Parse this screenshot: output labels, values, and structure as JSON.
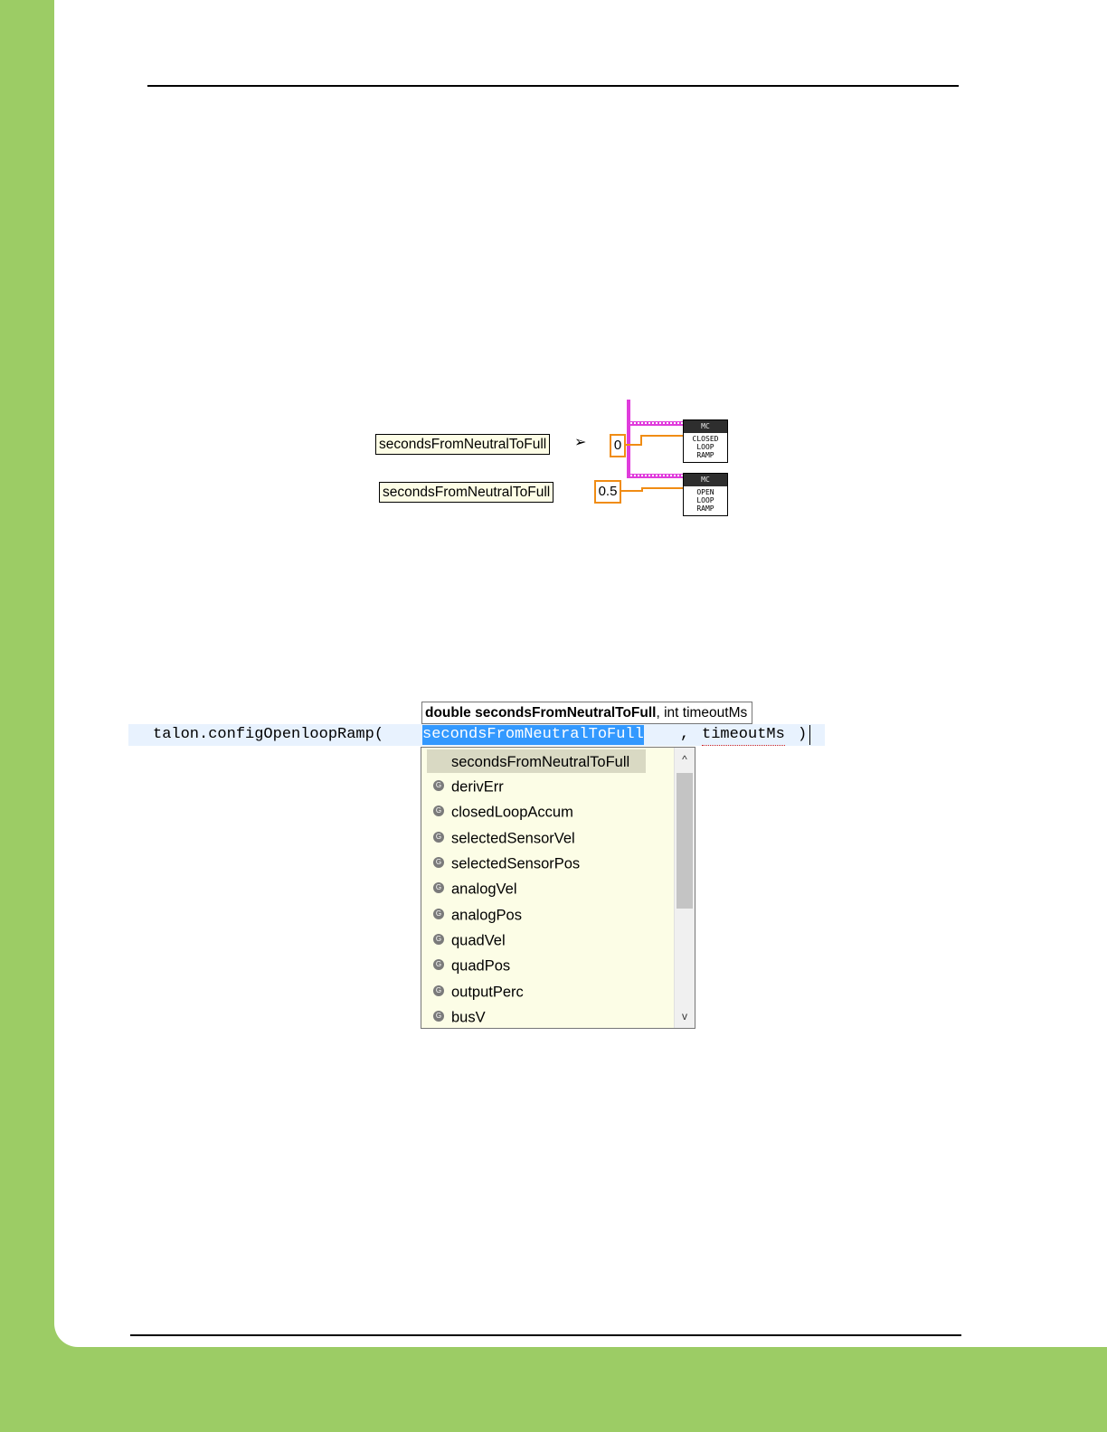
{
  "diagram": {
    "closed": {
      "label": "secondsFromNeutralToFull",
      "value": "0",
      "vi_head": "MC",
      "vi_body": [
        "CLOSED",
        "LOOP",
        "RAMP"
      ]
    },
    "open": {
      "label": "secondsFromNeutralToFull",
      "value": "0.5",
      "vi_head": "MC",
      "vi_body": [
        "OPEN",
        "LOOP",
        "RAMP"
      ]
    }
  },
  "code": {
    "hint_bold": "double secondsFromNeutralToFull",
    "hint_rest": ", int timeoutMs",
    "prefix": "talon.configOpenloopRamp(",
    "selected_param": "secondsFromNeutralToFull",
    "comma": ", ",
    "second_param": "timeoutMs",
    "suffix": ")"
  },
  "autocomplete": {
    "selected": "secondsFromNeutralToFull",
    "items": [
      "derivErr",
      "closedLoopAccum",
      "selectedSensorVel",
      "selectedSensorPos",
      "analogVel",
      "analogPos",
      "quadVel",
      "quadPos",
      "outputPerc",
      "busV"
    ],
    "item_icon": "field-icon",
    "scroll_up": "^",
    "scroll_down": "v"
  },
  "colors": {
    "page_green": "#9ccc65",
    "wire_orange": "#f08c14",
    "wire_magenta": "#e03cdc",
    "selection_blue": "#3399ff"
  }
}
